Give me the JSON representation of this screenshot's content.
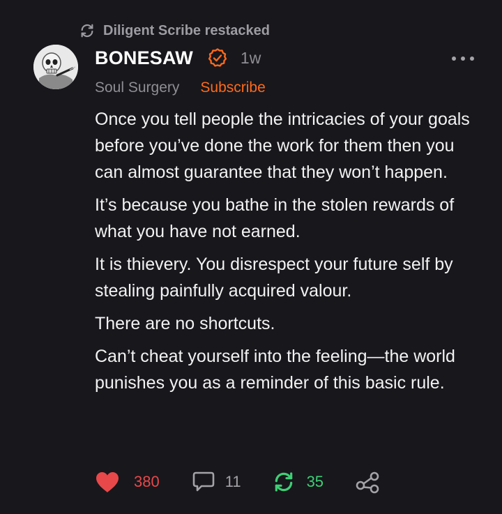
{
  "restack": {
    "icon": "restack-icon",
    "text": "Diligent Scribe restacked"
  },
  "post": {
    "author": "BONESAW",
    "verified_icon": "verified-badge-icon",
    "time": "1w",
    "publication": "Soul Surgery",
    "subscribe_label": "Subscribe",
    "paragraphs": [
      "Once you tell people the intricacies of your goals before you’ve done the work for them then you can almost guarantee that they won’t happen.",
      "It’s because you bathe in the stolen rewards of what you have not earned.",
      "It is thievery. You disrespect your future self by stealing painfully acquired valour.",
      "There are no shortcuts.",
      "Can’t cheat yourself into the feeling—the world punishes you as a reminder of this basic rule."
    ]
  },
  "actions": {
    "likes": "380",
    "comments": "11",
    "restacks": "35"
  },
  "colors": {
    "background": "#18171c",
    "accent": "#ff6a1a",
    "like": "#e8484a",
    "restack": "#3ecf75",
    "muted": "#8e8e94"
  }
}
